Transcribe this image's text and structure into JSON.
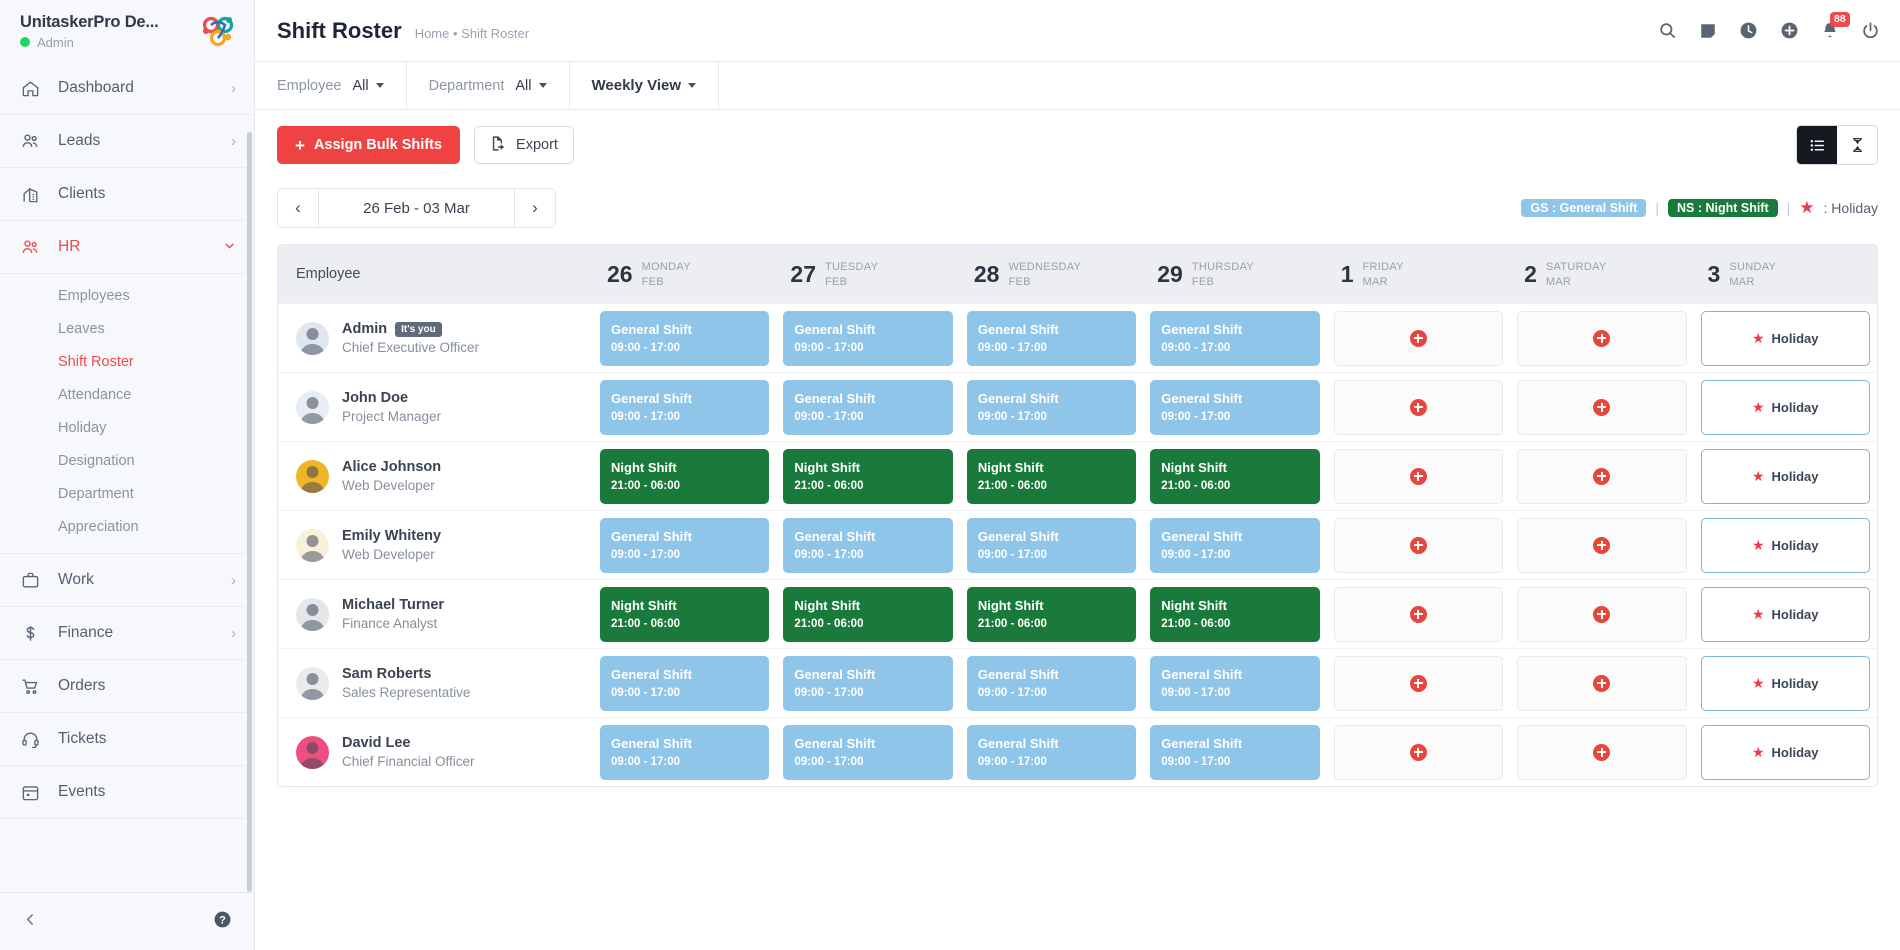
{
  "brand": {
    "name": "UnitaskerPro De...",
    "role": "Admin",
    "status_color": "#1ed760",
    "logo": "unitasker-logo-icon"
  },
  "sidebar": {
    "items": [
      {
        "label": "Dashboard",
        "icon": "home-icon",
        "chevron": "›",
        "active": false
      },
      {
        "label": "Leads",
        "icon": "users-icon",
        "chevron": "›",
        "active": false
      },
      {
        "label": "Clients",
        "icon": "building-icon",
        "chevron": "",
        "active": false
      },
      {
        "label": "HR",
        "icon": "users-icon",
        "chevron": "⌄",
        "active": true
      }
    ],
    "hr_subitems": [
      {
        "label": "Employees",
        "active": false
      },
      {
        "label": "Leaves",
        "active": false
      },
      {
        "label": "Shift Roster",
        "active": true
      },
      {
        "label": "Attendance",
        "active": false
      },
      {
        "label": "Holiday",
        "active": false
      },
      {
        "label": "Designation",
        "active": false
      },
      {
        "label": "Department",
        "active": false
      },
      {
        "label": "Appreciation",
        "active": false
      }
    ],
    "items_lower": [
      {
        "label": "Work",
        "icon": "briefcase-icon",
        "chevron": "›"
      },
      {
        "label": "Finance",
        "icon": "dollar-icon",
        "chevron": "›"
      },
      {
        "label": "Orders",
        "icon": "cart-icon",
        "chevron": ""
      },
      {
        "label": "Tickets",
        "icon": "headset-icon",
        "chevron": ""
      },
      {
        "label": "Events",
        "icon": "calendar-icon",
        "chevron": ""
      }
    ],
    "footer": {
      "collapse": "chevron-left-icon",
      "help": "help-icon"
    }
  },
  "header": {
    "title": "Shift Roster",
    "breadcrumb": "Home • Shift Roster",
    "icons": [
      {
        "name": "search-icon"
      },
      {
        "name": "note-icon"
      },
      {
        "name": "clock-icon"
      },
      {
        "name": "plus-circle-icon"
      },
      {
        "name": "bell-icon",
        "badge": "88"
      },
      {
        "name": "power-icon"
      }
    ]
  },
  "filters": [
    {
      "label": "Employee",
      "value": "All",
      "name": "employee-filter"
    },
    {
      "label": "Department",
      "value": "All",
      "name": "department-filter"
    },
    {
      "label": "",
      "value": "Weekly View",
      "name": "view-mode-filter"
    }
  ],
  "actions": {
    "assign_bulk": "Assign Bulk Shifts",
    "export": "Export",
    "view_toggle": [
      {
        "name": "list-view-toggle",
        "icon": "list-icon",
        "active": true
      },
      {
        "name": "timeline-view-toggle",
        "icon": "hourglass-icon",
        "active": false
      }
    ]
  },
  "date_nav": {
    "prev": "‹",
    "range": "26 Feb - 03 Mar",
    "next": "›"
  },
  "legend": [
    {
      "code": "GS : General Shift",
      "color": "#8ec5e8",
      "text_color": "#ffffff"
    },
    {
      "code": "NS : Night Shift",
      "color": "#1a7a3c",
      "text_color": "#ffffff"
    },
    {
      "code": ": Holiday",
      "icon": "star-icon",
      "color": "#ef3a4c"
    }
  ],
  "grid": {
    "employee_col_header": "Employee",
    "days": [
      {
        "num": "26",
        "name": "MONDAY",
        "month": "FEB"
      },
      {
        "num": "27",
        "name": "TUESDAY",
        "month": "FEB"
      },
      {
        "num": "28",
        "name": "WEDNESDAY",
        "month": "FEB"
      },
      {
        "num": "29",
        "name": "THURSDAY",
        "month": "FEB"
      },
      {
        "num": "1",
        "name": "FRIDAY",
        "month": "MAR"
      },
      {
        "num": "2",
        "name": "SATURDAY",
        "month": "MAR"
      },
      {
        "num": "3",
        "name": "SUNDAY",
        "month": "MAR"
      }
    ],
    "holiday_label": "Holiday",
    "shift_colors": {
      "general": "#8ec5e8",
      "night": "#1a7a3c"
    },
    "rows": [
      {
        "name": "Admin",
        "role": "Chief Executive Officer",
        "badge": "It's you",
        "avatar_color": "#dfe6ee",
        "cells": [
          {
            "type": "shift",
            "kind": "general",
            "name": "General Shift",
            "time": "09:00 - 17:00"
          },
          {
            "type": "shift",
            "kind": "general",
            "name": "General Shift",
            "time": "09:00 - 17:00"
          },
          {
            "type": "shift",
            "kind": "general",
            "name": "General Shift",
            "time": "09:00 - 17:00"
          },
          {
            "type": "shift",
            "kind": "general",
            "name": "General Shift",
            "time": "09:00 - 17:00"
          },
          {
            "type": "empty"
          },
          {
            "type": "empty"
          },
          {
            "type": "holiday"
          }
        ]
      },
      {
        "name": "John Doe",
        "role": "Project Manager",
        "badge": "",
        "avatar_color": "#e8edf3",
        "cells": [
          {
            "type": "shift",
            "kind": "general",
            "name": "General Shift",
            "time": "09:00 - 17:00"
          },
          {
            "type": "shift",
            "kind": "general",
            "name": "General Shift",
            "time": "09:00 - 17:00"
          },
          {
            "type": "shift",
            "kind": "general",
            "name": "General Shift",
            "time": "09:00 - 17:00"
          },
          {
            "type": "shift",
            "kind": "general",
            "name": "General Shift",
            "time": "09:00 - 17:00"
          },
          {
            "type": "empty"
          },
          {
            "type": "empty"
          },
          {
            "type": "holiday"
          }
        ]
      },
      {
        "name": "Alice Johnson",
        "role": "Web Developer",
        "badge": "",
        "avatar_color": "#f0b429",
        "cells": [
          {
            "type": "shift",
            "kind": "night",
            "name": "Night Shift",
            "time": "21:00 - 06:00"
          },
          {
            "type": "shift",
            "kind": "night",
            "name": "Night Shift",
            "time": "21:00 - 06:00"
          },
          {
            "type": "shift",
            "kind": "night",
            "name": "Night Shift",
            "time": "21:00 - 06:00"
          },
          {
            "type": "shift",
            "kind": "night",
            "name": "Night Shift",
            "time": "21:00 - 06:00"
          },
          {
            "type": "empty"
          },
          {
            "type": "empty"
          },
          {
            "type": "holiday"
          }
        ]
      },
      {
        "name": "Emily Whiteny",
        "role": "Web Developer",
        "badge": "",
        "avatar_color": "#f7f1dc",
        "cells": [
          {
            "type": "shift",
            "kind": "general",
            "name": "General Shift",
            "time": "09:00 - 17:00"
          },
          {
            "type": "shift",
            "kind": "general",
            "name": "General Shift",
            "time": "09:00 - 17:00"
          },
          {
            "type": "shift",
            "kind": "general",
            "name": "General Shift",
            "time": "09:00 - 17:00"
          },
          {
            "type": "shift",
            "kind": "general",
            "name": "General Shift",
            "time": "09:00 - 17:00"
          },
          {
            "type": "empty"
          },
          {
            "type": "empty"
          },
          {
            "type": "holiday"
          }
        ]
      },
      {
        "name": "Michael Turner",
        "role": "Finance Analyst",
        "badge": "",
        "avatar_color": "#e3e7ea",
        "cells": [
          {
            "type": "shift",
            "kind": "night",
            "name": "Night Shift",
            "time": "21:00 - 06:00"
          },
          {
            "type": "shift",
            "kind": "night",
            "name": "Night Shift",
            "time": "21:00 - 06:00"
          },
          {
            "type": "shift",
            "kind": "night",
            "name": "Night Shift",
            "time": "21:00 - 06:00"
          },
          {
            "type": "shift",
            "kind": "night",
            "name": "Night Shift",
            "time": "21:00 - 06:00"
          },
          {
            "type": "empty"
          },
          {
            "type": "empty"
          },
          {
            "type": "holiday"
          }
        ]
      },
      {
        "name": "Sam Roberts",
        "role": "Sales Representative",
        "badge": "",
        "avatar_color": "#e9ebee",
        "cells": [
          {
            "type": "shift",
            "kind": "general",
            "name": "General Shift",
            "time": "09:00 - 17:00"
          },
          {
            "type": "shift",
            "kind": "general",
            "name": "General Shift",
            "time": "09:00 - 17:00"
          },
          {
            "type": "shift",
            "kind": "general",
            "name": "General Shift",
            "time": "09:00 - 17:00"
          },
          {
            "type": "shift",
            "kind": "general",
            "name": "General Shift",
            "time": "09:00 - 17:00"
          },
          {
            "type": "empty"
          },
          {
            "type": "empty"
          },
          {
            "type": "holiday"
          }
        ]
      },
      {
        "name": "David Lee",
        "role": "Chief Financial Officer",
        "badge": "",
        "avatar_color": "#ef4f7e",
        "cells": [
          {
            "type": "shift",
            "kind": "general",
            "name": "General Shift",
            "time": "09:00 - 17:00"
          },
          {
            "type": "shift",
            "kind": "general",
            "name": "General Shift",
            "time": "09:00 - 17:00"
          },
          {
            "type": "shift",
            "kind": "general",
            "name": "General Shift",
            "time": "09:00 - 17:00"
          },
          {
            "type": "shift",
            "kind": "general",
            "name": "General Shift",
            "time": "09:00 - 17:00"
          },
          {
            "type": "empty"
          },
          {
            "type": "empty"
          },
          {
            "type": "holiday"
          }
        ]
      }
    ]
  }
}
